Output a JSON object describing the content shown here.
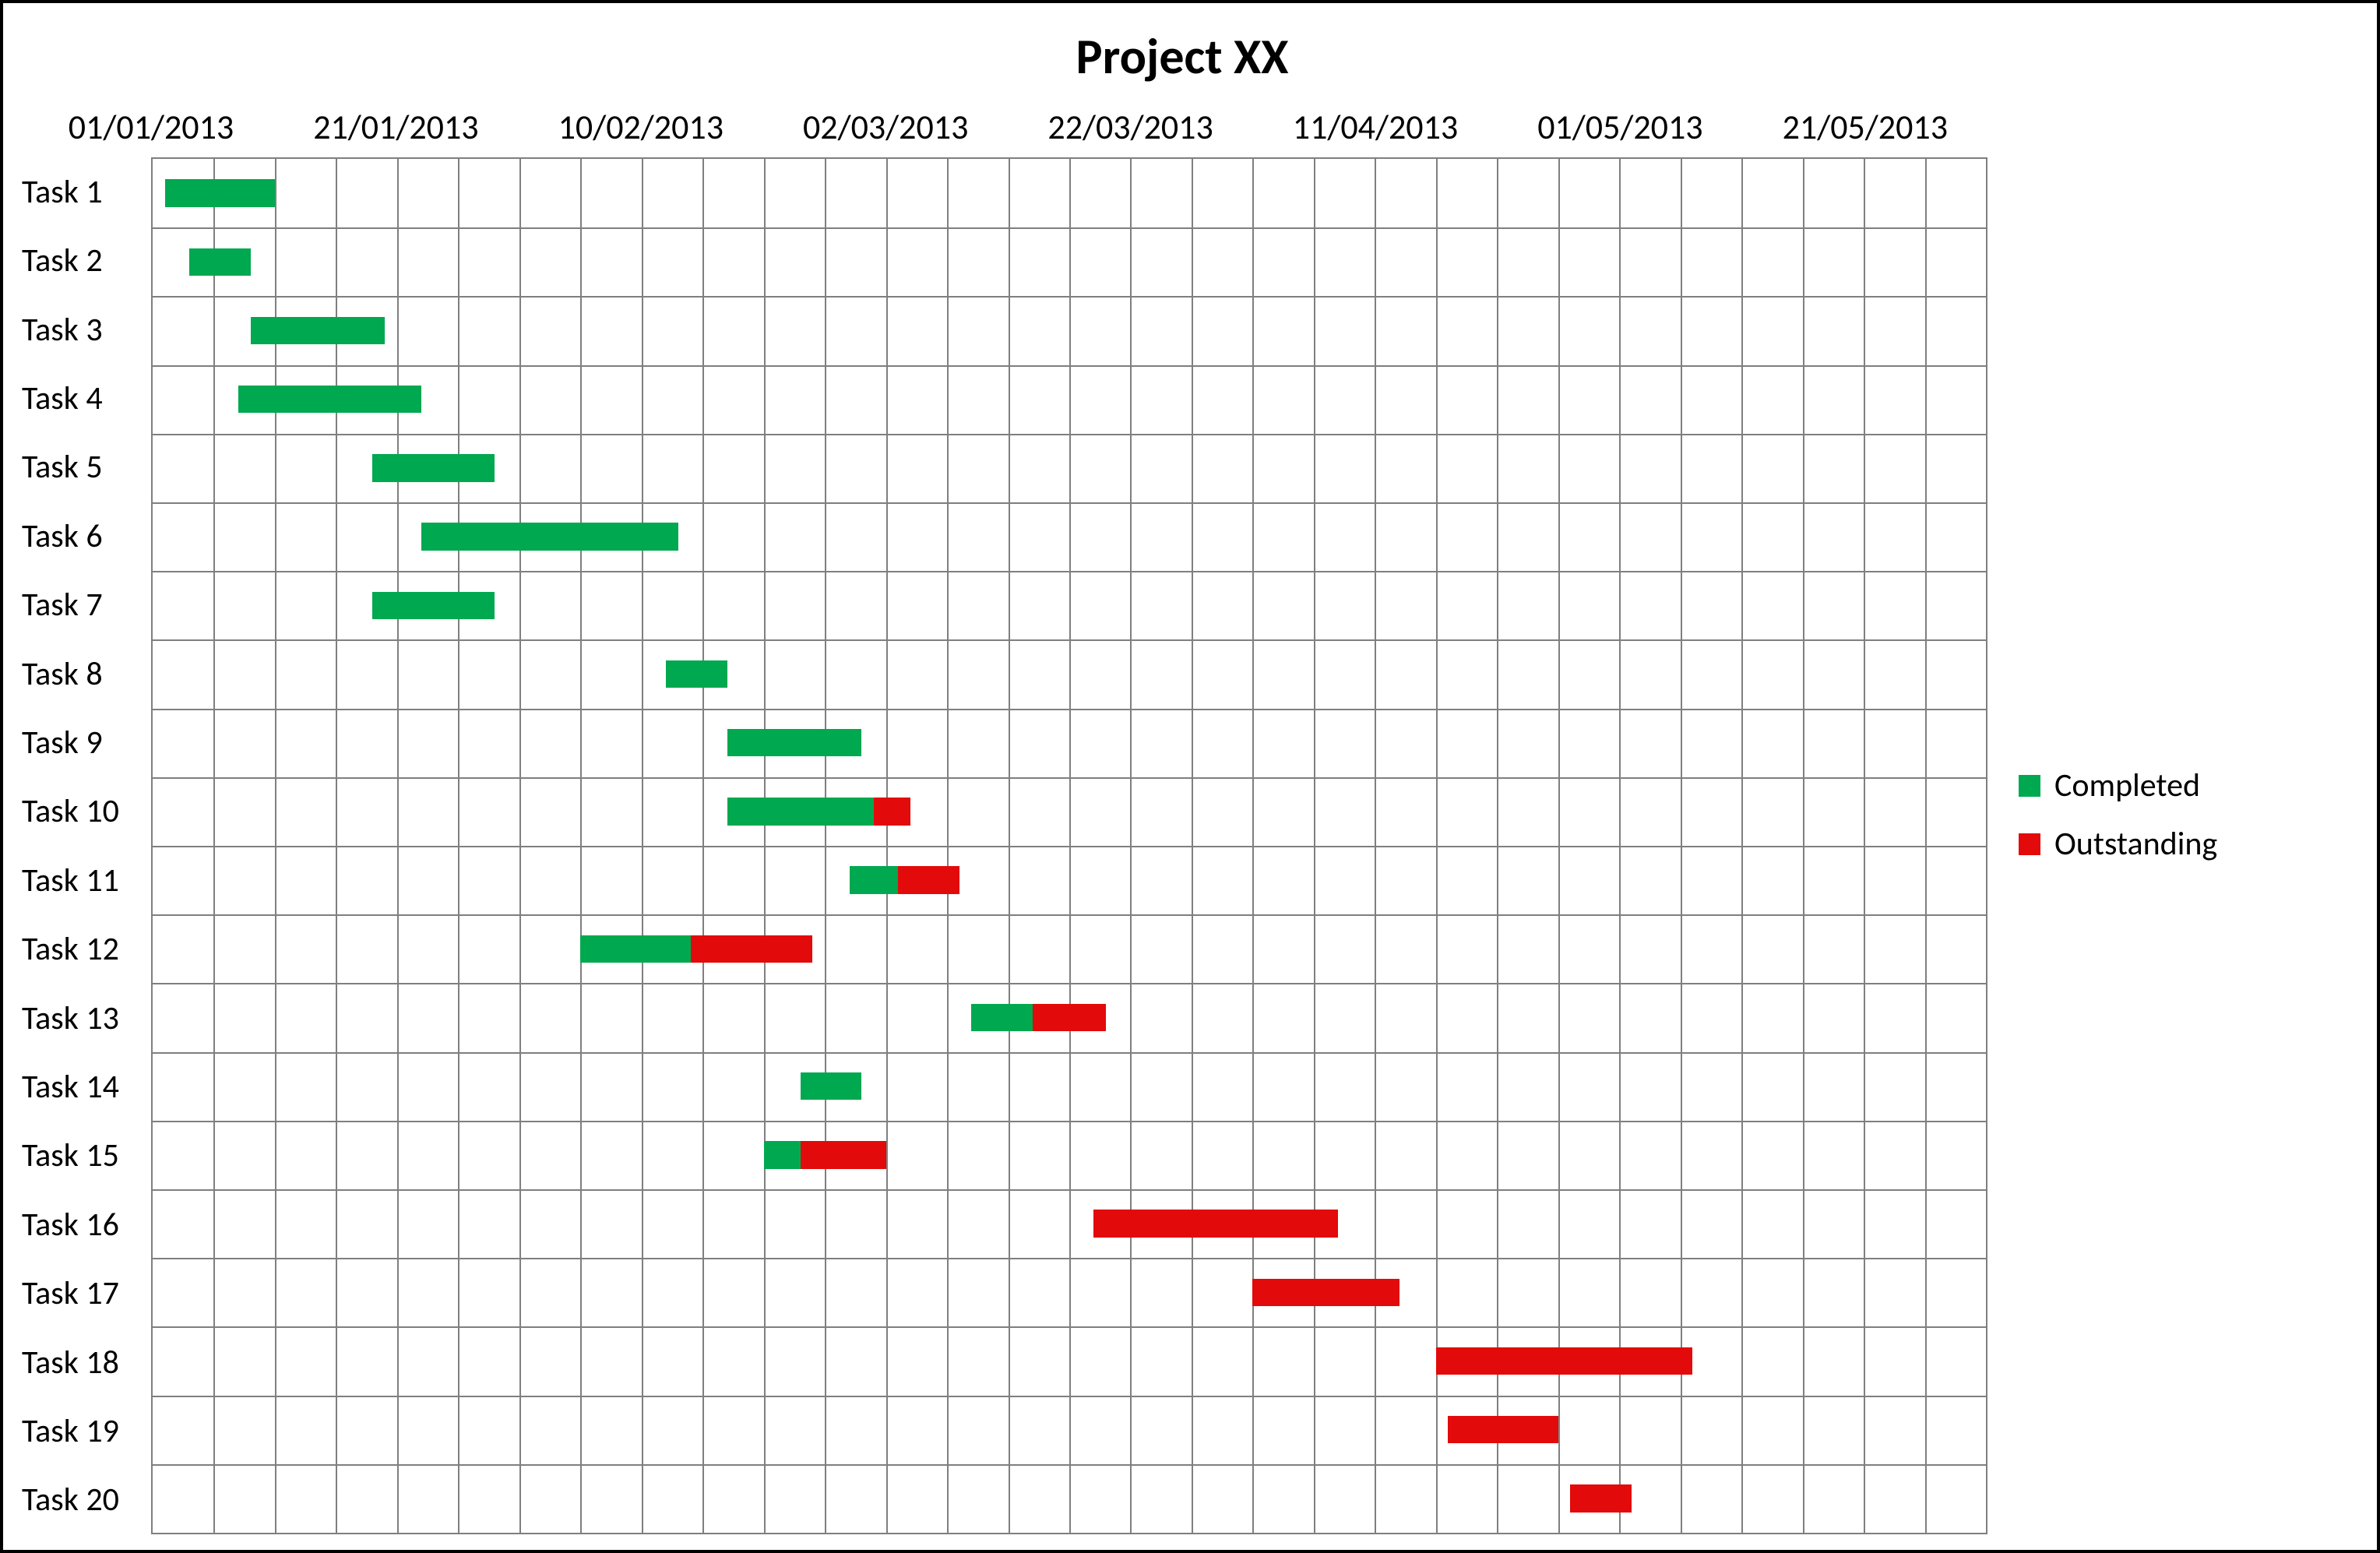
{
  "chart_data": {
    "type": "bar",
    "title": "Project XX",
    "x_axis": {
      "min_date": "2013-01-01",
      "max_date": "2013-05-31",
      "tick_dates": [
        "01/01/2013",
        "21/01/2013",
        "10/02/2013",
        "02/03/2013",
        "22/03/2013",
        "11/04/2013",
        "01/05/2013",
        "21/05/2013"
      ],
      "tick_day_indices": [
        0,
        20,
        40,
        60,
        80,
        100,
        120,
        140
      ],
      "range_days": 150
    },
    "legend": {
      "items": [
        {
          "key": "completed",
          "label": "Completed",
          "color": "#00a84f"
        },
        {
          "key": "outstanding",
          "label": "Outstanding",
          "color": "#e20a0a"
        }
      ]
    },
    "series_meta": [
      "start_day_index_from_2013-01-01",
      "completed_days",
      "outstanding_days"
    ],
    "tasks": [
      {
        "label": "Task 1",
        "start": 1,
        "completed": 9,
        "outstanding": 0
      },
      {
        "label": "Task 2",
        "start": 3,
        "completed": 5,
        "outstanding": 0
      },
      {
        "label": "Task 3",
        "start": 8,
        "completed": 11,
        "outstanding": 0
      },
      {
        "label": "Task 4",
        "start": 7,
        "completed": 15,
        "outstanding": 0
      },
      {
        "label": "Task 5",
        "start": 18,
        "completed": 10,
        "outstanding": 0
      },
      {
        "label": "Task 6",
        "start": 22,
        "completed": 21,
        "outstanding": 0
      },
      {
        "label": "Task 7",
        "start": 18,
        "completed": 10,
        "outstanding": 0
      },
      {
        "label": "Task 8",
        "start": 42,
        "completed": 5,
        "outstanding": 0
      },
      {
        "label": "Task 9",
        "start": 47,
        "completed": 11,
        "outstanding": 0
      },
      {
        "label": "Task 10",
        "start": 47,
        "completed": 12,
        "outstanding": 3
      },
      {
        "label": "Task 11",
        "start": 57,
        "completed": 4,
        "outstanding": 5
      },
      {
        "label": "Task 12",
        "start": 35,
        "completed": 9,
        "outstanding": 10
      },
      {
        "label": "Task 13",
        "start": 67,
        "completed": 5,
        "outstanding": 6
      },
      {
        "label": "Task 14",
        "start": 53,
        "completed": 5,
        "outstanding": 0
      },
      {
        "label": "Task 15",
        "start": 50,
        "completed": 3,
        "outstanding": 7
      },
      {
        "label": "Task 16",
        "start": 77,
        "completed": 0,
        "outstanding": 20
      },
      {
        "label": "Task 17",
        "start": 90,
        "completed": 0,
        "outstanding": 12
      },
      {
        "label": "Task 18",
        "start": 105,
        "completed": 0,
        "outstanding": 21
      },
      {
        "label": "Task 19",
        "start": 106,
        "completed": 0,
        "outstanding": 9
      },
      {
        "label": "Task 20",
        "start": 116,
        "completed": 0,
        "outstanding": 5
      }
    ],
    "minor_grid_days": 5
  }
}
